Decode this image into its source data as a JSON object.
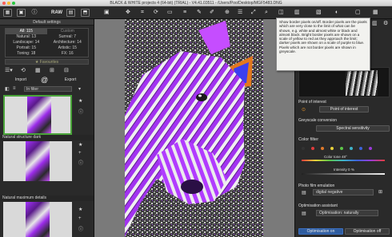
{
  "window": {
    "title": "BLACK & WHITE projects 4 (64-bit) (TRIAL) - V4.41.03511 - /Users/Poo/Desktop/MGF5483.DNG",
    "colors": {
      "close": "#fc5f57",
      "minimize": "#fdbc2e",
      "maximize": "#28c840"
    }
  },
  "toolbar": {
    "raw_label": "RAW",
    "icons": [
      "grid-icon",
      "image-icon",
      "raw-icon",
      "save-icon",
      "export-icon",
      "panel-icon",
      "cursor-icon",
      "crop-icon",
      "rotate-icon",
      "frame-icon",
      "lines-icon",
      "pencil-icon",
      "paint-icon",
      "zoom-icon",
      "stack-icon",
      "expand-icon",
      "magnify-icon",
      "split-icon",
      "compare-icon",
      "layers-icon",
      "fill-icon",
      "window-icon"
    ]
  },
  "left_panel": {
    "header": "Default settings",
    "presets": [
      [
        {
          "label": "All: 115",
          "selected": true
        },
        {
          "label": "Custom",
          "dim": true
        }
      ],
      [
        {
          "label": "Natural: 13"
        },
        {
          "label": "Surreal: 7"
        }
      ],
      [
        {
          "label": "Landscape: 14"
        },
        {
          "label": "Architecture: 14"
        }
      ],
      [
        {
          "label": "Portrait: 15"
        },
        {
          "label": "Artistic: 15"
        }
      ],
      [
        {
          "label": "Toning: 18"
        },
        {
          "label": "FX: 16"
        }
      ]
    ],
    "favorites_label": "Favourites",
    "import_label": "Import",
    "export_label": "Export",
    "at_symbol": "@",
    "filter_value": "In filter",
    "cards": [
      {
        "name": ""
      },
      {
        "name": "Natural structure dark"
      },
      {
        "name": "Natural maximum details"
      }
    ]
  },
  "tooltip": {
    "text": "Show border pixels on/off. Border pixels are the pixels which are very close to the limit of what can be shown, e.g. white and almost white or black and almost black. Bright border pixels are shown on a scale of yellow to red as they approach the limit; darker pixels are shown on a scale of purple to blue. Pixels which are not border pixels are shown in greyscale."
  },
  "right_panel": {
    "point_of_interest_title": "Point of interest",
    "point_of_interest_button": "Point of interest",
    "greyscale_title": "Greyscale conversion",
    "spectral_button": "Spectral sensitivity",
    "color_filter_label": "Color filter",
    "filter_colors": [
      "#333333",
      "#e03c3c",
      "#e07a2a",
      "#e8d23a",
      "#5cc548",
      "#3fb3c8",
      "#3c62d8",
      "#9a3ad8"
    ],
    "color_tone_label": "Color tone",
    "color_tone_value": "48",
    "color_tone_unit": "°",
    "intensity_label": "Intensity",
    "intensity_value": "0",
    "intensity_unit": "%",
    "photo_film_title": "Photo film emulation",
    "film_value": "digital negative",
    "optimization_title": "Optimisation assistant",
    "optimization_value": "Optimisation: naturally",
    "optimization_on": "Optimisation on",
    "optimization_off": "Optimisation off"
  }
}
